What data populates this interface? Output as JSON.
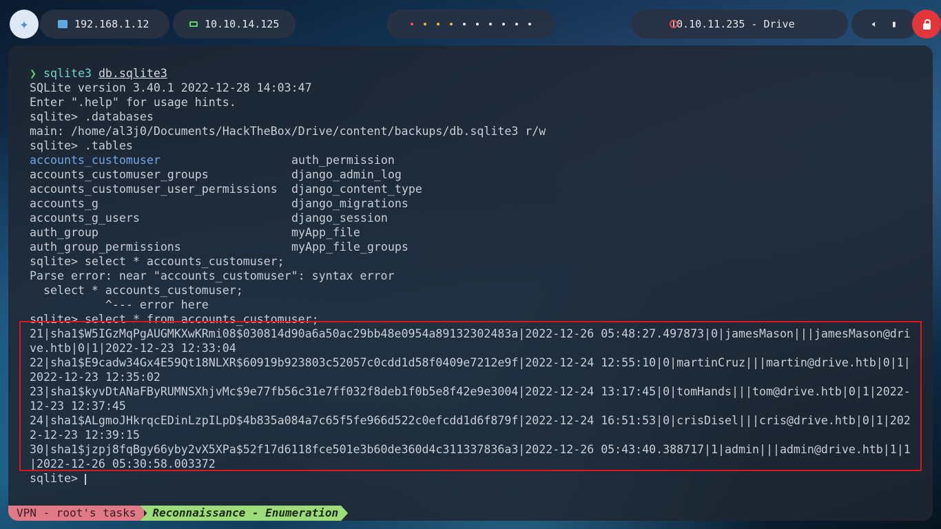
{
  "topbar": {
    "local_ip": "192.168.1.12",
    "vpn_ip": "10.10.14.125",
    "target": "10.10.11.235 - Drive",
    "workspace_count": 10,
    "active_workspace_colors": [
      "#e85858",
      "#e8c040",
      "#e8c040",
      "#e8c040"
    ]
  },
  "terminal": {
    "prompt_symbol": "❯",
    "command_prefix": "sqlite3 ",
    "command_arg": "db.sqlite3",
    "lines_pre": [
      "SQLite version 3.40.1 2022-12-28 14:03:47",
      "Enter \".help\" for usage hints.",
      "sqlite> .databases",
      "main: /home/al3j0/Documents/HackTheBox/Drive/content/backups/db.sqlite3 r/w",
      "sqlite> .tables"
    ],
    "tables": [
      [
        "accounts_customuser",
        "auth_permission"
      ],
      [
        "accounts_customuser_groups",
        "django_admin_log"
      ],
      [
        "accounts_customuser_user_permissions",
        "django_content_type"
      ],
      [
        "accounts_g",
        "django_migrations"
      ],
      [
        "accounts_g_users",
        "django_session"
      ],
      [
        "auth_group",
        "myApp_file"
      ],
      [
        "auth_group_permissions",
        "myApp_file_groups"
      ]
    ],
    "lines_mid": [
      "sqlite> select * accounts_customuser;",
      "Parse error: near \"accounts_customuser\": syntax error",
      "  select * accounts_customuser;",
      "           ^--- error here",
      "sqlite> select * from accounts_customuser;"
    ],
    "result_rows": [
      "21|sha1$W5IGzMqPgAUGMKXwKRmi08$030814d90a6a50ac29bb48e0954a89132302483a|2022-12-26 05:48:27.497873|0|jamesMason|||jamesMason@dri",
      "ve.htb|0|1|2022-12-23 12:33:04",
      "22|sha1$E9cadw34Gx4E59Qt18NLXR$60919b923803c52057c0cdd1d58f0409e7212e9f|2022-12-24 12:55:10|0|martinCruz|||martin@drive.htb|0|1|",
      "2022-12-23 12:35:02",
      "23|sha1$kyvDtANaFByRUMNSXhjvMc$9e77fb56c31e7ff032f8deb1f0b5e8f42e9e3004|2022-12-24 13:17:45|0|tomHands|||tom@drive.htb|0|1|2022-",
      "12-23 12:37:45",
      "24|sha1$ALgmoJHkrqcEDinLzpILpD$4b835a084a7c65f5fe966d522c0efcdd1d6f879f|2022-12-24 16:51:53|0|crisDisel|||cris@drive.htb|0|1|202",
      "2-12-23 12:39:15",
      "30|sha1$jzpj8fqBgy66yby2vX5XPa$52f17d6118fce501e3b60de360d4c311337836a3|2022-12-26 05:43:40.388717|1|admin|||admin@drive.htb|1|1",
      "|2022-12-26 05:30:58.003372"
    ],
    "final_prompt": "sqlite> "
  },
  "statusbar": {
    "session": "VPN - root's tasks",
    "window": "Reconnaissance - Enumeration"
  },
  "colors": {
    "highlight_border": "#e0141c",
    "lock_button": "#e2363b"
  }
}
